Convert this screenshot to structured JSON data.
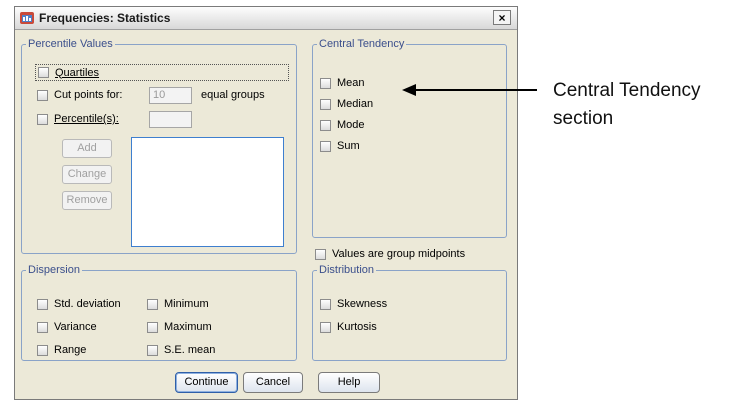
{
  "window": {
    "title": "Frequencies: Statistics",
    "close_glyph": "×"
  },
  "percentile_values": {
    "legend": "Percentile Values",
    "quartiles": "Quartiles",
    "cut_points_label": "Cut points for:",
    "cut_points_value": "10",
    "cut_points_suffix": "equal groups",
    "percentiles_label": "Percentile(s):",
    "percentiles_value": "",
    "add": "Add",
    "change": "Change",
    "remove": "Remove"
  },
  "central_tendency": {
    "legend": "Central Tendency",
    "mean": "Mean",
    "median": "Median",
    "mode": "Mode",
    "sum": "Sum"
  },
  "group_midpoints": "Values are group midpoints",
  "dispersion": {
    "legend": "Dispersion",
    "std_deviation": "Std. deviation",
    "minimum": "Minimum",
    "variance": "Variance",
    "maximum": "Maximum",
    "range": "Range",
    "se_mean": "S.E. mean"
  },
  "distribution": {
    "legend": "Distribution",
    "skewness": "Skewness",
    "kurtosis": "Kurtosis"
  },
  "footer": {
    "continue": "Continue",
    "cancel": "Cancel",
    "help": "Help"
  },
  "annotation": {
    "line1": "Central Tendency",
    "line2": "section"
  },
  "icons": {
    "app": "spss-app-icon",
    "close": "close-icon",
    "arrow": "arrow-left-icon"
  }
}
